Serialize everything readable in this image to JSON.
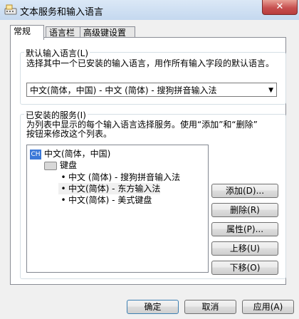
{
  "window": {
    "title": "文本服务和输入语言",
    "close_label": "✕"
  },
  "tabs": [
    {
      "label": "常规",
      "active": true
    },
    {
      "label": "语言栏",
      "active": false
    },
    {
      "label": "高级键设置",
      "active": false
    }
  ],
  "default_language": {
    "group_label": "默认输入语言(L)",
    "description": "选择其中一个已安装的输入语言，用作所有输入字段的默认语言。",
    "selected": "中文(简体，中国) - 中文 (简体) - 搜狗拼音输入法",
    "arrow": "▼"
  },
  "installed_services": {
    "group_label": "已安装的服务(I)",
    "description_line1": "为列表中显示的每个输入语言选择服务。使用“添加”和“删除”",
    "description_line2": "按钮来修改这个列表。",
    "tree": {
      "language": "中文(简体，中国)",
      "language_icon": "CH",
      "category": "键盘",
      "items": [
        "中文 (简体) - 搜狗拼音输入法",
        "中文(简体) - 东方输入法",
        "中文(简体) - 美式键盘"
      ],
      "bullet": "•"
    },
    "buttons": {
      "add": "添加(D)...",
      "remove": "删除(R)",
      "properties": "属性(P)...",
      "move_up": "上移(U)",
      "move_down": "下移(O)"
    }
  },
  "footer": {
    "ok": "确定",
    "cancel": "取消",
    "apply": "应用(A)"
  }
}
